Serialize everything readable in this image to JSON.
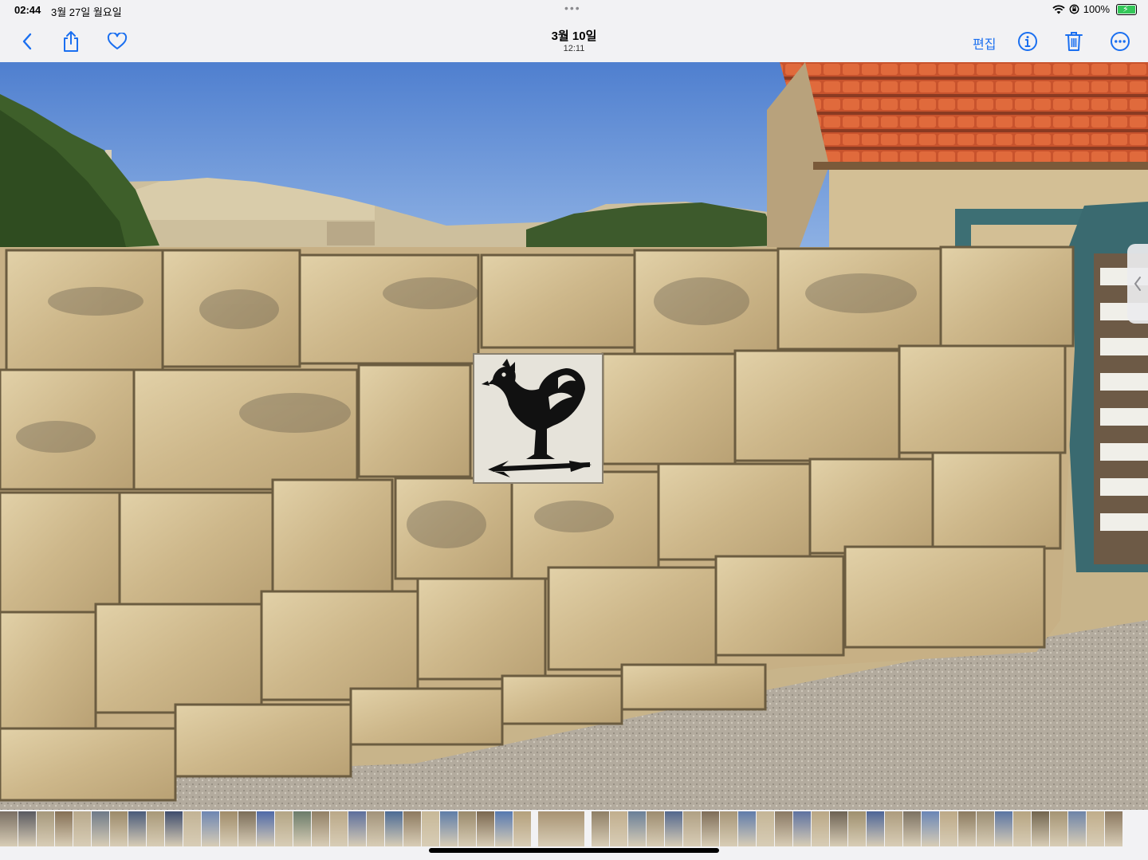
{
  "status_bar": {
    "time": "02:44",
    "date": "3월 27일 월요일",
    "battery": "100%",
    "icons": [
      "wifi-icon",
      "orientation-lock-icon",
      "battery-charging-icon"
    ]
  },
  "nav": {
    "title": "3월 10일",
    "subtitle": "12:11",
    "edit_label": "편집",
    "left_icons": [
      "back-chevron-icon",
      "share-icon",
      "favorite-heart-icon"
    ],
    "right_icons": [
      "info-icon",
      "trash-icon",
      "more-ellipsis-icon"
    ],
    "accent_color": "#1a6ff0"
  },
  "thumbnail_strip": {
    "count": 59,
    "current_index": 29,
    "colors": [
      "#7a6f63",
      "#5a5a60",
      "#a6987c",
      "#857055",
      "#b8a98c",
      "#6f7a88",
      "#9c8a6a",
      "#4a5b7a",
      "#a89878",
      "#3f4d6d",
      "#c2b395",
      "#6e86b2",
      "#a08c6a",
      "#7c6e5a",
      "#4f6aa8",
      "#b3a585",
      "#6b7c6a",
      "#928066",
      "#baa888",
      "#5d6f9c",
      "#a2937a",
      "#4c6b95",
      "#8d7a60",
      "#c7b898",
      "#5f7da8",
      "#9a8a6c",
      "#7b6850",
      "#5779b0",
      "#b4a07c",
      "#a89373",
      "#8f7f66",
      "#c1ae8e",
      "#6a7f98",
      "#9d8c70",
      "#54688e",
      "#b0a084",
      "#7e6d58",
      "#a79678",
      "#607caa",
      "#c4b596",
      "#8a7964",
      "#5e72a0",
      "#b9a785",
      "#6d6254",
      "#9f906f",
      "#4d6597",
      "#ad9c7e",
      "#7d7262",
      "#6a86b6",
      "#bca987",
      "#8c7b60",
      "#9b8d73",
      "#5b75a3",
      "#b6a481",
      "#72654f",
      "#a59474",
      "#6e84a8",
      "#c0ad8a",
      "#8b7860"
    ]
  }
}
